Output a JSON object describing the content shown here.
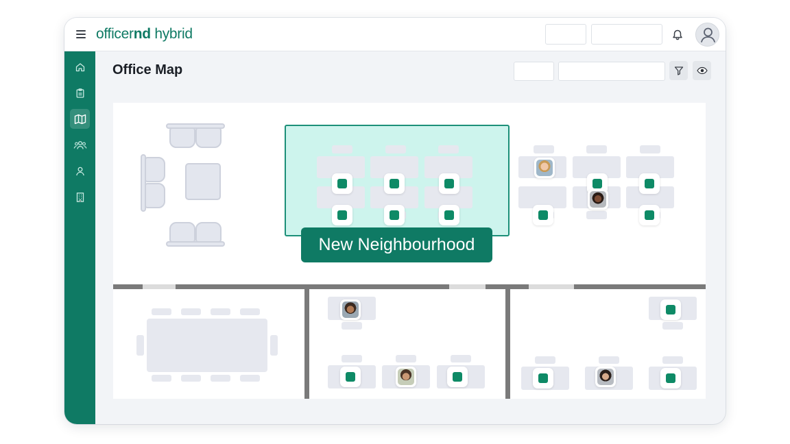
{
  "app": {
    "logo_regular": "officer",
    "logo_bold": "nd",
    "logo_suffix": " hybrid"
  },
  "header": {
    "title": "Office Map"
  },
  "sidebar": {
    "items": [
      {
        "icon": "home-icon"
      },
      {
        "icon": "clipboard-icon"
      },
      {
        "icon": "map-icon",
        "active": true
      },
      {
        "icon": "people-icon"
      },
      {
        "icon": "person-icon"
      },
      {
        "icon": "building-icon"
      }
    ]
  },
  "map": {
    "neighbourhood_label": "New Neighbourhood"
  },
  "colors": {
    "brand": "#0f7a64",
    "desk_available": "#0e8a66",
    "neighbourhood_fill": "#c9f2ea",
    "background": "#f2f4f7"
  }
}
